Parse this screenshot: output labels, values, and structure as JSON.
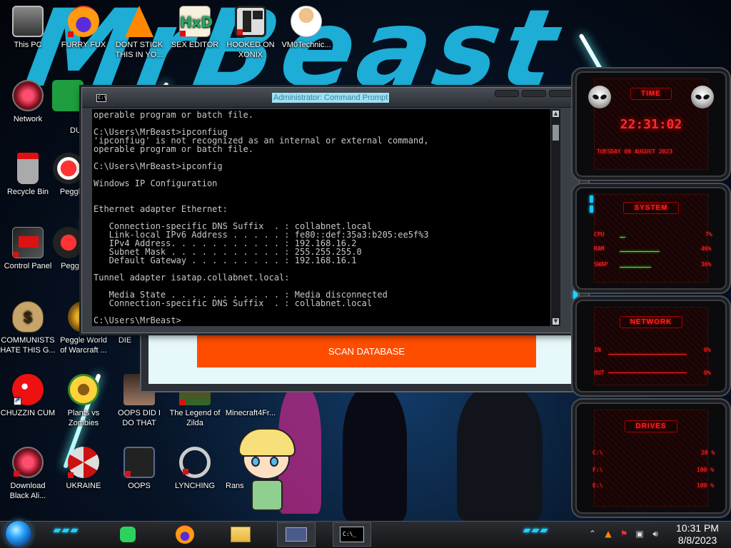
{
  "wallpaper": {
    "brand_text": "MrBeast"
  },
  "desktop_icons": [
    {
      "id": "this-pc",
      "label": "This PC"
    },
    {
      "id": "furry-fux",
      "label": "FURRY FUX"
    },
    {
      "id": "dont-stick",
      "label": "DONT STICK THIS IN YO..."
    },
    {
      "id": "sex-editor",
      "label": "SEX EDITOR"
    },
    {
      "id": "hooked-on-xonix",
      "label": "HOOKED ON XONIX"
    },
    {
      "id": "vm0technic",
      "label": "VM0Technic..."
    },
    {
      "id": "network",
      "label": "Network"
    },
    {
      "id": "du",
      "label": "DU"
    },
    {
      "id": "recycle-bin",
      "label": "Recycle Bin"
    },
    {
      "id": "peggle-1",
      "label": "Peggl"
    },
    {
      "id": "control-panel",
      "label": "Control Panel"
    },
    {
      "id": "peggle-2",
      "label": "Pegg"
    },
    {
      "id": "communists",
      "label": "COMMUNISTS HATE THIS G..."
    },
    {
      "id": "peggle-wow",
      "label": "Peggle World of Warcraft ..."
    },
    {
      "id": "die",
      "label": "DIE"
    },
    {
      "id": "chuzzin-cum",
      "label": "CHUZZIN CUM"
    },
    {
      "id": "plants-vs-zombies",
      "label": "Plants vs Zombies"
    },
    {
      "id": "oops-did-i",
      "label": "OOPS DID I DO THAT"
    },
    {
      "id": "legend-zilda",
      "label": "The Legend of Zilda"
    },
    {
      "id": "minecraft",
      "label": "Minecraft4Fr..."
    },
    {
      "id": "download-black",
      "label": "Download Black Ali..."
    },
    {
      "id": "ukraine",
      "label": "UKRAINE"
    },
    {
      "id": "oops",
      "label": "OOPS"
    },
    {
      "id": "lynching",
      "label": "LYNCHING"
    },
    {
      "id": "rans",
      "label": "Rans"
    }
  ],
  "scan_window": {
    "button_label": "SCAN DATABASE"
  },
  "cmd": {
    "title": "Administrator: Command Prompt",
    "icon_text": "C:\\",
    "lines": [
      "operable program or batch file.",
      "",
      "C:\\Users\\MrBeast>ipconfiug",
      "'ipconfiug' is not recognized as an internal or external command,",
      "operable program or batch file.",
      "",
      "C:\\Users\\MrBeast>ipconfig",
      "",
      "Windows IP Configuration",
      "",
      "",
      "Ethernet adapter Ethernet:",
      "",
      "   Connection-specific DNS Suffix  . : collabnet.local",
      "   Link-local IPv6 Address . . . . . : fe80::def:35a3:b205:ee5f%3",
      "   IPv4 Address. . . . . . . . . . . : 192.168.16.2",
      "   Subnet Mask . . . . . . . . . . . : 255.255.255.0",
      "   Default Gateway . . . . . . . . . : 192.168.16.1",
      "",
      "Tunnel adapter isatap.collabnet.local:",
      "",
      "   Media State . . . . . . . . . . . : Media disconnected",
      "   Connection-specific DNS Suffix  . : collabnet.local",
      "",
      "C:\\Users\\MrBeast>"
    ]
  },
  "gadgets": {
    "time": {
      "title": "TIME",
      "clock": "22:31:02",
      "date": "TUESDAY 08 AUGUST 2023"
    },
    "system": {
      "title": "SYSTEM",
      "rows": [
        {
          "label": "CPU",
          "value": "7%",
          "fill": 0.07
        },
        {
          "label": "RAM",
          "value": "46%",
          "fill": 0.46
        },
        {
          "label": "SWAP",
          "value": "36%",
          "fill": 0.36
        }
      ]
    },
    "network": {
      "title": "NETWORK",
      "rows": [
        {
          "label": "IN",
          "value": "0%"
        },
        {
          "label": "OUT",
          "value": "0%"
        }
      ]
    },
    "drives": {
      "title": "DRIVES",
      "rows": [
        {
          "label": "C:\\",
          "value": "28 %"
        },
        {
          "label": "F:\\",
          "value": "100 %"
        },
        {
          "label": "E:\\",
          "value": "100 %"
        }
      ]
    }
  },
  "taskbar": {
    "apps": [
      "spotify",
      "firefox",
      "file-explorer",
      "control-panel-app",
      "command-prompt"
    ],
    "cmd_icon_text": "C:\\_",
    "time": "10:31 PM",
    "date": "8/8/2023"
  }
}
